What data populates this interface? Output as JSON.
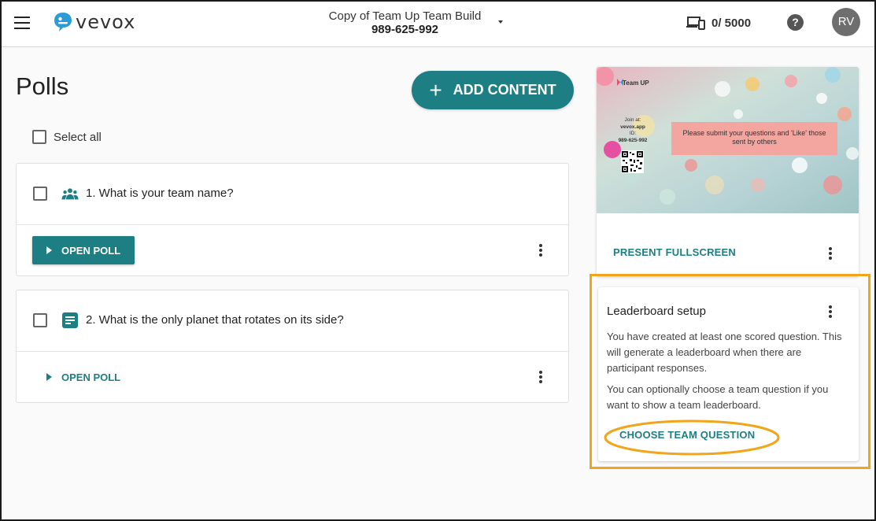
{
  "header": {
    "app_name": "vevox",
    "event_name": "Copy of Team Up Team Build",
    "event_code": "989-625-992",
    "device_count": "0/ 5000",
    "help_label": "?",
    "user_initials": "RV"
  },
  "main": {
    "title": "Polls",
    "add_content_label": "ADD CONTENT",
    "select_all_label": "Select all",
    "polls": [
      {
        "question": "1. What is your team name?",
        "open_label": "OPEN POLL",
        "icon": "team-icon"
      },
      {
        "question": "2. What is the only planet that rotates on its side?",
        "open_label": "OPEN POLL",
        "icon": "text-question-icon"
      }
    ]
  },
  "preview": {
    "slide_brand": "Team UP",
    "join_lines": [
      "Join at:",
      "vevox.app",
      "ID:",
      "989-625-992"
    ],
    "slide_message": "Please submit your questions and 'Like' those sent by others",
    "present_label": "PRESENT FULLSCREEN"
  },
  "leaderboard": {
    "title": "Leaderboard setup",
    "paragraph1": "You have created at least one scored question. This will generate a leaderboard when there are participant responses.",
    "paragraph2": "You can optionally choose a team question if you want to show a team leaderboard.",
    "choose_label": "CHOOSE TEAM QUESTION"
  },
  "colors": {
    "accent": "#1d7e83",
    "highlight": "#f0a51b",
    "slide_message_bg": "#f3a5a0"
  }
}
